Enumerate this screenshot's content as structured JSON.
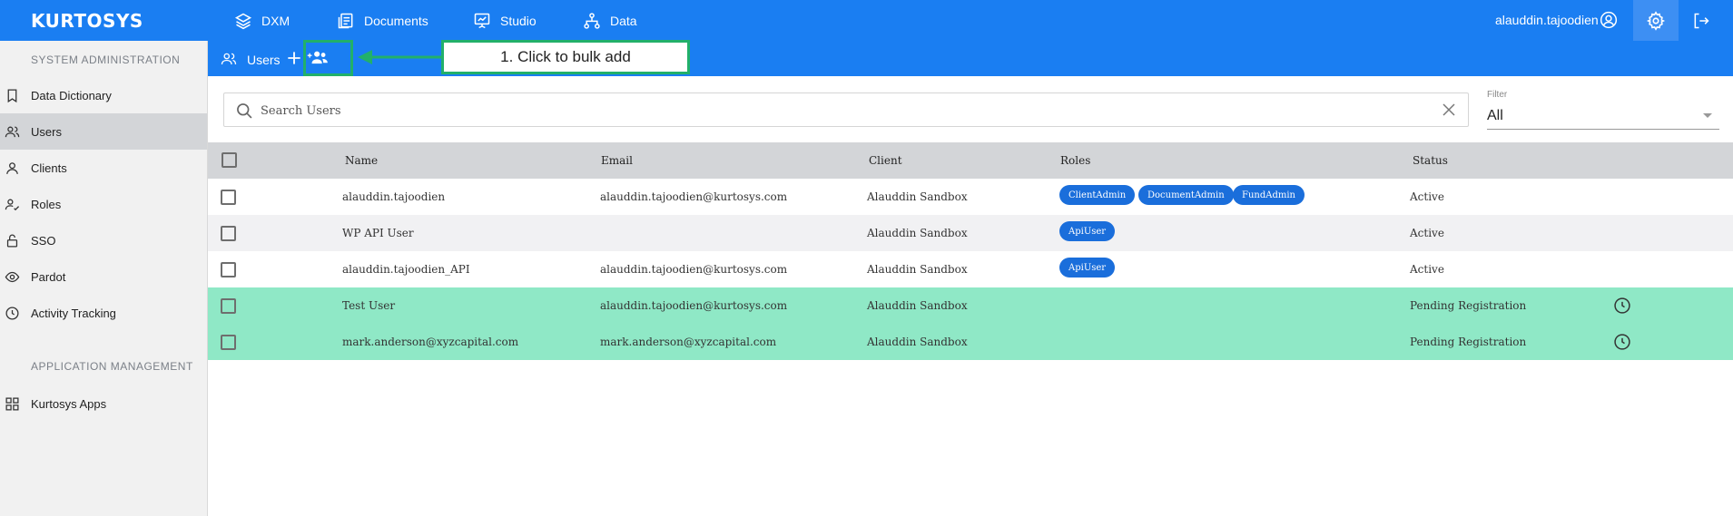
{
  "app": {
    "logo": "KURTOSYS"
  },
  "topnav": {
    "items": [
      {
        "label": "DXM",
        "icon": "layers-icon"
      },
      {
        "label": "Documents",
        "icon": "documents-icon"
      },
      {
        "label": "Studio",
        "icon": "presentation-icon"
      },
      {
        "label": "Data",
        "icon": "hierarchy-icon"
      }
    ],
    "username": "alauddin.tajoodien"
  },
  "sidebar": {
    "section1": "SYSTEM ADMINISTRATION",
    "items": [
      {
        "label": "Data Dictionary",
        "icon": "bookmark-icon"
      },
      {
        "label": "Users",
        "icon": "users-icon",
        "active": true
      },
      {
        "label": "Clients",
        "icon": "user-icon"
      },
      {
        "label": "Roles",
        "icon": "user-check-icon"
      },
      {
        "label": "SSO",
        "icon": "lock-icon"
      },
      {
        "label": "Pardot",
        "icon": "eye-icon"
      },
      {
        "label": "Activity Tracking",
        "icon": "clock-icon"
      }
    ],
    "section2": "APPLICATION MANAGEMENT",
    "apps": {
      "label": "Kurtosys Apps",
      "icon": "grid-icon"
    }
  },
  "subbar": {
    "title": "Users"
  },
  "callout": {
    "text": "1. Click to bulk add"
  },
  "search": {
    "placeholder": "Search Users",
    "value": ""
  },
  "filter": {
    "label": "Filter",
    "value": "All"
  },
  "table": {
    "headers": {
      "name": "Name",
      "email": "Email",
      "client": "Client",
      "roles": "Roles",
      "status": "Status"
    },
    "rows": [
      {
        "name": "alauddin.tajoodien",
        "email": "alauddin.tajoodien@kurtosys.com",
        "client": "Alauddin Sandbox",
        "roles": [
          "ClientAdmin",
          "DocumentAdmin",
          "FundAdmin"
        ],
        "status": "Active",
        "pending": false
      },
      {
        "name": "WP API User",
        "email": "",
        "client": "Alauddin Sandbox",
        "roles": [
          "ApiUser"
        ],
        "status": "Active",
        "pending": false
      },
      {
        "name": "alauddin.tajoodien_API",
        "email": "alauddin.tajoodien@kurtosys.com",
        "client": "Alauddin Sandbox",
        "roles": [
          "ApiUser"
        ],
        "status": "Active",
        "pending": false
      },
      {
        "name": "Test User",
        "email": "alauddin.tajoodien@kurtosys.com",
        "client": "Alauddin Sandbox",
        "roles": [],
        "status": "Pending Registration",
        "pending": true
      },
      {
        "name": "mark.anderson@xyzcapital.com",
        "email": "mark.anderson@xyzcapital.com",
        "client": "Alauddin Sandbox",
        "roles": [],
        "status": "Pending Registration",
        "pending": true
      }
    ]
  },
  "colors": {
    "primary": "#1a7ef2",
    "pending_row": "#8fe8c6",
    "highlight": "#22b06a",
    "chip": "#1a6edb"
  }
}
